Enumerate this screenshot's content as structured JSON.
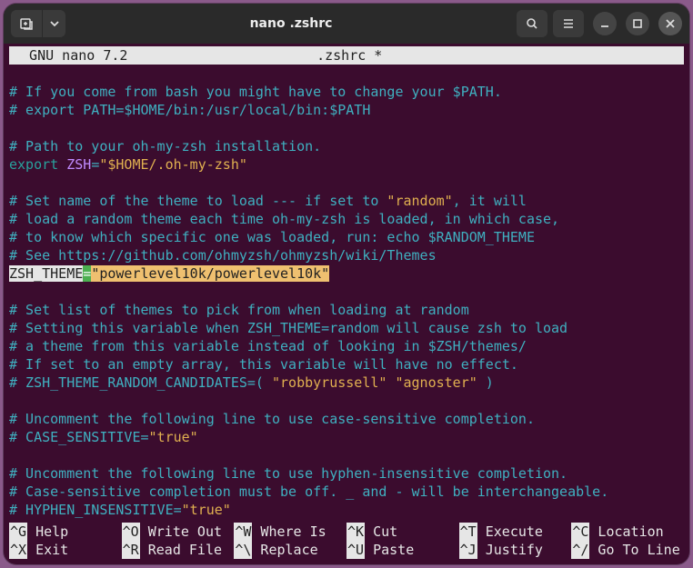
{
  "titlebar": {
    "title": "nano .zshrc"
  },
  "status": {
    "app": "  GNU nano 7.2",
    "filename": ".zshrc *"
  },
  "lines": {
    "l1": "# If you come from bash you might have to change your $PATH.",
    "l2": "# export PATH=$HOME/bin:/usr/local/bin:$PATH",
    "l3": "",
    "l4": "# Path to your oh-my-zsh installation.",
    "l5a": "export",
    "l5b": " ZSH",
    "l5c": "=",
    "l5d": "\"$HOME/.oh-my-zsh\"",
    "l6": "",
    "l7a": "# Set name of the theme to load --- if set to ",
    "l7b": "\"random\"",
    "l7c": ", it will",
    "l8": "# load a random theme each time oh-my-zsh is loaded, in which case,",
    "l9": "# to know which specific one was loaded, run: echo $RANDOM_THEME",
    "l10": "# See https://github.com/ohmyzsh/ohmyzsh/wiki/Themes",
    "l11a": "ZSH_THEME",
    "l11b": "=",
    "l11c": "\"powerlevel10k/powerlevel10k\"",
    "l12": "",
    "l13": "# Set list of themes to pick from when loading at random",
    "l14": "# Setting this variable when ZSH_THEME=random will cause zsh to load",
    "l15": "# a theme from this variable instead of looking in $ZSH/themes/",
    "l16": "# If set to an empty array, this variable will have no effect.",
    "l17a": "# ZSH_THEME_RANDOM_CANDIDATES=( ",
    "l17b": "\"robbyrussell\"",
    "l17c": " ",
    "l17d": "\"agnoster\"",
    "l17e": " )",
    "l18": "",
    "l19": "# Uncomment the following line to use case-sensitive completion.",
    "l20a": "# CASE_SENSITIVE=",
    "l20b": "\"true\"",
    "l21": "",
    "l22": "# Uncomment the following line to use hyphen-insensitive completion.",
    "l23": "# Case-sensitive completion must be off. _ and - will be interchangeable.",
    "l24a": "# HYPHEN_INSENSITIVE=",
    "l24b": "\"true\""
  },
  "shortcuts": [
    {
      "key": "^G",
      "label": "Help"
    },
    {
      "key": "^O",
      "label": "Write Out"
    },
    {
      "key": "^W",
      "label": "Where Is"
    },
    {
      "key": "^K",
      "label": "Cut"
    },
    {
      "key": "^T",
      "label": "Execute"
    },
    {
      "key": "^C",
      "label": "Location"
    },
    {
      "key": "^X",
      "label": "Exit"
    },
    {
      "key": "^R",
      "label": "Read File"
    },
    {
      "key": "^\\",
      "label": "Replace"
    },
    {
      "key": "^U",
      "label": "Paste"
    },
    {
      "key": "^J",
      "label": "Justify"
    },
    {
      "key": "^/",
      "label": "Go To Line"
    }
  ]
}
